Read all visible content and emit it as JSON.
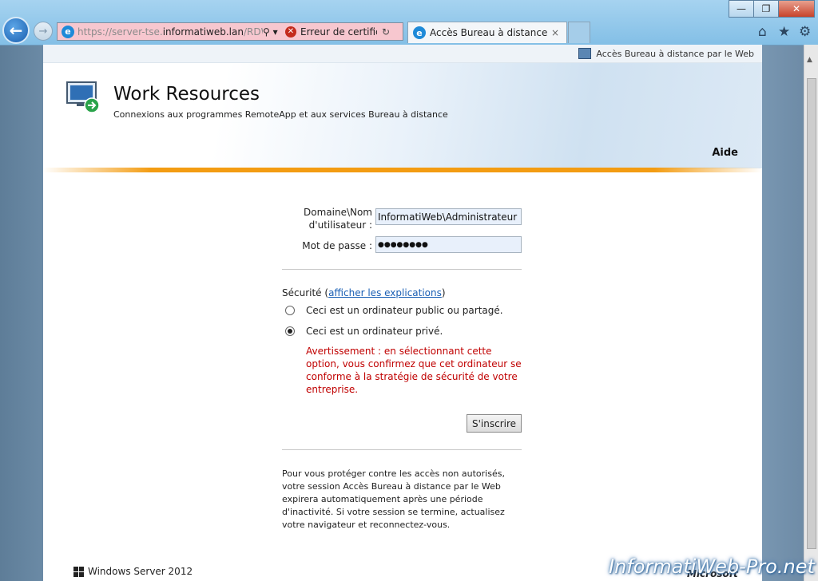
{
  "browser": {
    "address": {
      "url_prefix": "https://server-tse.",
      "url_domain": "informatiweb.lan",
      "url_path": "/RDWeb/",
      "cert_error": "Erreur de certificat"
    },
    "tab": {
      "label": "Accès Bureau à distance pa...",
      "close": "×"
    },
    "window": {
      "minimize": "—",
      "maximize": "❐",
      "close": "✕"
    },
    "icons": {
      "back": "←",
      "forward": "→",
      "home": "⌂",
      "favorites": "★",
      "settings": "⚙",
      "search": "⚲ ▾",
      "refresh": "↻"
    }
  },
  "site": {
    "top_link": "Accès Bureau à distance par le Web",
    "title": "Work Resources",
    "subtitle": "Connexions aux programmes RemoteApp et aux services Bureau à distance",
    "help": "Aide"
  },
  "form": {
    "username_label": "Domaine\\Nom d'utilisateur :",
    "username_value": "InformatiWeb\\Administrateur",
    "password_label": "Mot de passe :",
    "password_value": "●●●●●●●●",
    "security_prefix": "Sécurité (",
    "security_link": "afficher les explications",
    "security_suffix": ")",
    "option_public": "Ceci est un ordinateur public ou partagé.",
    "option_private": "Ceci est un ordinateur privé.",
    "selected_option": "private",
    "warning": "Avertissement : en sélectionnant cette option, vous confirmez que cet ordinateur se conforme à la stratégie de sécurité de votre entreprise.",
    "submit_label": "S'inscrire",
    "note": "Pour vous protéger contre les accès non autorisés, votre session Accès Bureau à distance par le Web expirera automatiquement après une période d'inactivité. Si votre session se termine, actualisez votre navigateur et reconnectez-vous."
  },
  "footer": {
    "os_label": "Windows Server 2012",
    "vendor": "Microsoft"
  },
  "watermark": "InformatiWeb-Pro.net"
}
